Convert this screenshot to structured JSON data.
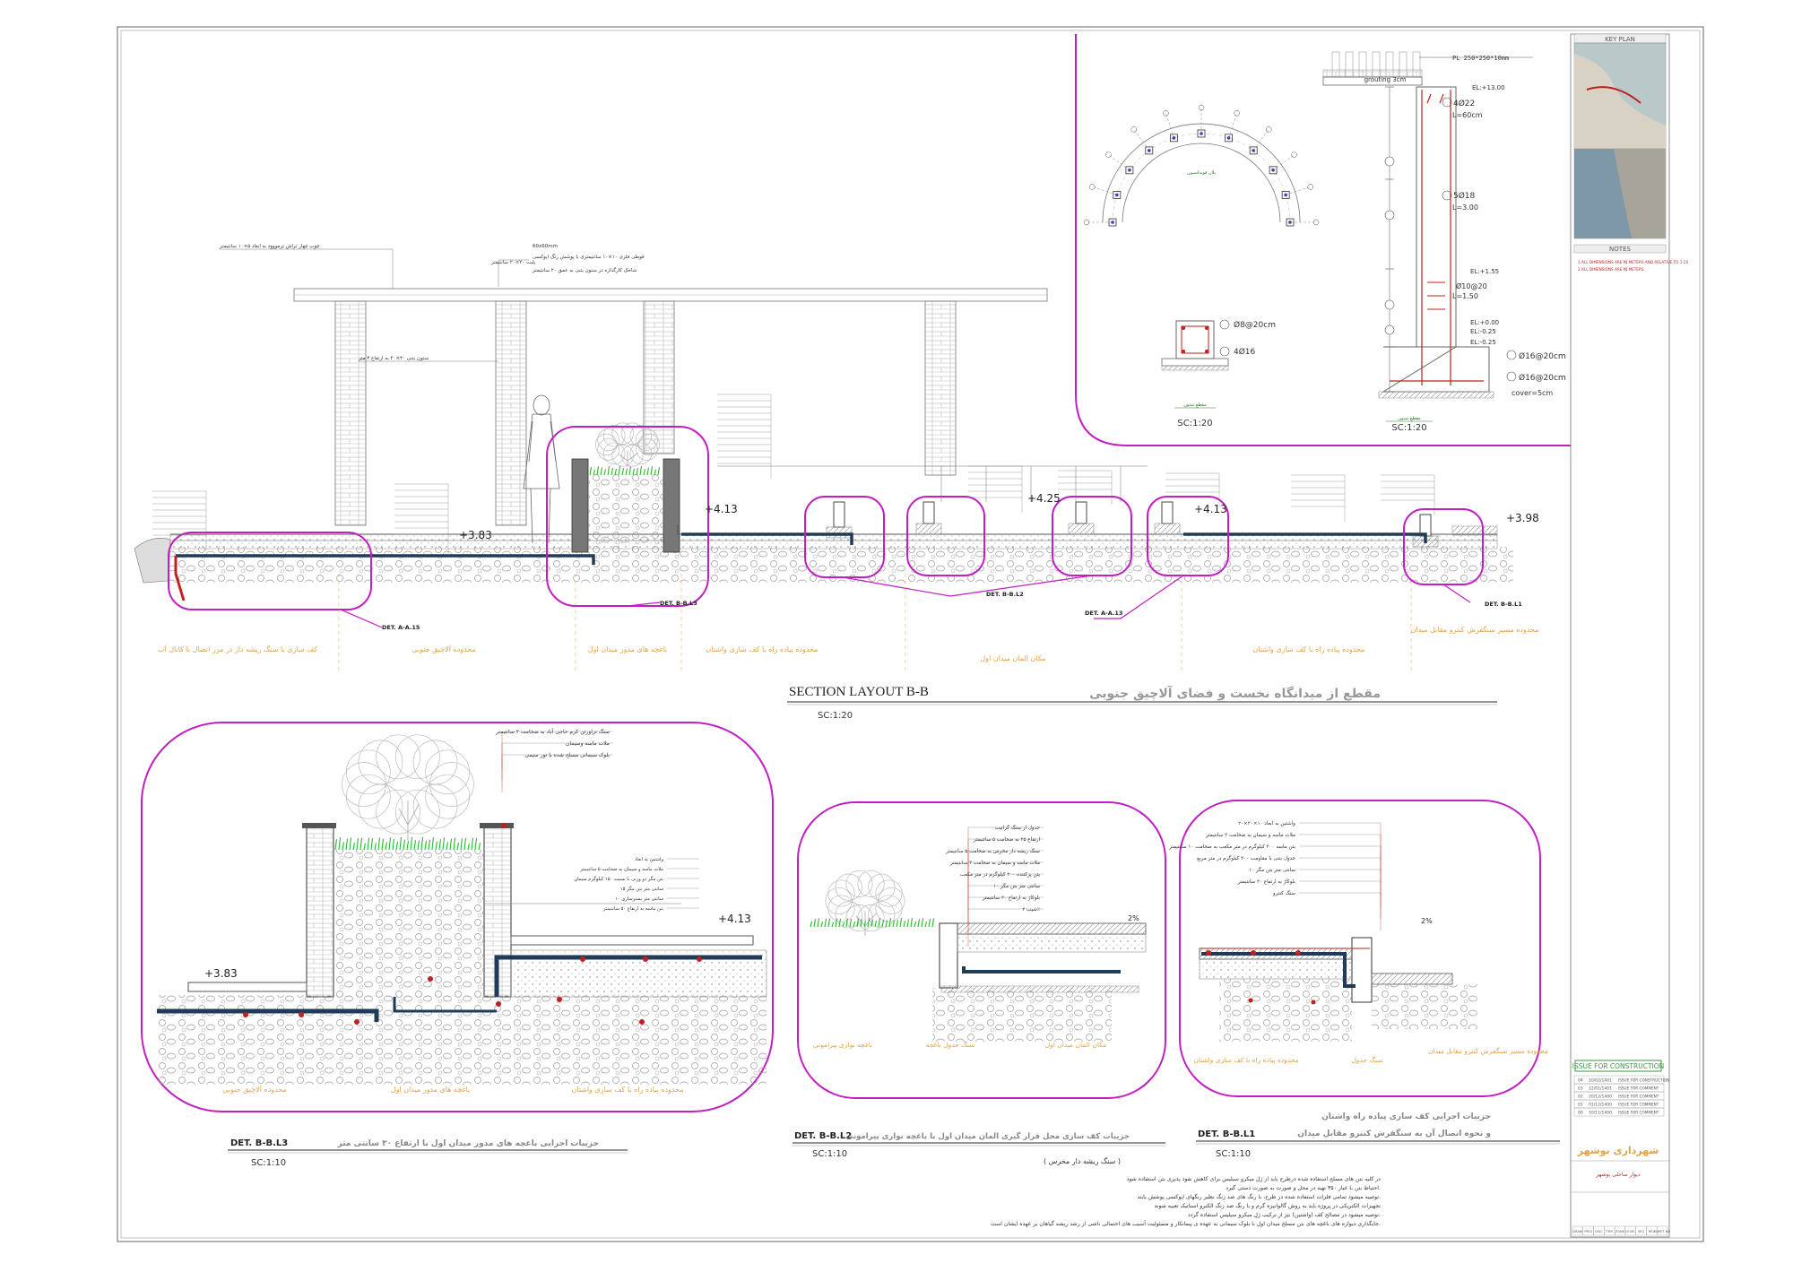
{
  "section_main": {
    "title": "SECTION LAYOUT B-B",
    "title_fa": "مقطع از میدانگاه نخست و فضای آلاچیق جنوبی",
    "scale": "SC:1:20",
    "levels": [
      "+3.83",
      "+4.13",
      "+4.25",
      "+4.13",
      "+3.98"
    ],
    "det_labels": [
      "DET. A-A.15",
      "DET. B-B.L3",
      "DET. B-B.L2",
      "DET. A-A.13",
      "DET. B-B.L1"
    ],
    "zones": [
      "کف سازی با سنگ ریشه دار در مرز اتصال با کانال آب",
      "محدوده آلاچیق جنوبی",
      "باغچه های مدور میدان اول",
      "محدوده پیاده راه با کف سازی واشتان",
      "مکان المان میدان اول",
      "محدوده پیاده راه با کف سازی واشتان",
      "محدوده مسیر سنگفرش کنترو مقابل میدان"
    ],
    "pergola_notes": [
      "چوب چهار تراش ترمووود به ابعاد ۵×۱۰ سانتیمتر",
      "60x60mm",
      "قوطی فلزی ۱۰×۱۰ سانتیمتری با پوشش رنگ اپوکسی",
      "پلیت ۲۰×۲۰ سانتیمتر",
      "شاخک کارگذاره در ستون بتنی به عمق ۲۰ سانتیمتر",
      "ستون بتنی ۴۰×۴۰ به ارتفاع ۳ متر"
    ]
  },
  "arch_detail": {
    "label": "پلان فونداسیون",
    "scale": "SC:1:20"
  },
  "column_detail": {
    "plate": "PL 250*250*10mm",
    "grouting": "grouting 3cm",
    "rebar_notes": [
      "4Ø22",
      "L=60cm",
      "5Ø18",
      "L=3.00",
      "Ø10@20",
      "L=1.50",
      "Ø16@20cm",
      "Ø16@20cm",
      "cover=5cm"
    ],
    "levels": [
      "EL:+13.00",
      "EL:+1.55",
      "EL:+0.00",
      "EL:-0.25",
      "EL:-0.25"
    ],
    "section_rebar": [
      "Ø8@20cm",
      "4Ø16"
    ],
    "label_left": "مقطع ستون",
    "label_right": "مقطع ستون",
    "scale_left": "SC:1:20",
    "scale_right": "SC:1:20"
  },
  "detail_l3": {
    "id": "DET. B-B.L3",
    "title_fa": "جزییات اجرایی باغچه های مدور میدان اول با ارتفاع ۳۰ سانتی متر",
    "scale": "SC:1:10",
    "levels": [
      "+3.83",
      "+4.13"
    ],
    "notes": [
      "سنگ تراورتن کرم حاجی آباد به ضخامت ۲ سانتیمتر",
      "ملات ماسه وسیمان",
      "بلوک سیمانی مسلح شده با تور سیمی",
      "واشتین به ابعاد",
      "ملات ماسه و سیمان به ضخامت ۵ سانتیمتر",
      "بتن مگر دو وزنی با نسبت ۱۵۰ کیلوگرم سیمان",
      "۱۵ سانتی متر بتن مگر",
      "۱۰ سانتی متر بسترسازی",
      "بتن ماسه به ارتفاع ۵۰ سانتیمتر"
    ],
    "zones": [
      "محدوده آلاچیق جنوبی",
      "باغچه های مدور میدان اول",
      "محدوده پیاده راه با کف سازی واشتان"
    ]
  },
  "detail_l2": {
    "id": "DET. B-B.L2",
    "title_fa": "جزییات کف سازی محل قرار گیری المان میدان اول با باغچه نواری پیرامونی",
    "subtitle_fa": "( سنگ ریشه دار مخرس )",
    "scale": "SC:1:10",
    "notes": [
      "جدول از سنگ گرانیت",
      "ارتفاع ۲۵ به ضخامت ۵ سانتیمتر",
      "سنگ ریشه دار مخرس به ضخامت ۵ سانتیمتر",
      "ملات ماسه و سیمان به ضخامت ۳ سانتیمتر",
      "بتن پرکننده ۲۰۰ کیلوگرم در متر مکعب",
      "۱۰ سانتی متر بتن مگر",
      "بلوکاژ به ارتفاع ۲۰ سانتیمتر",
      "شیب ۲٪"
    ],
    "slope": "2%",
    "zones": [
      "باغچه نواری پیرامونی",
      "سنگ جدول باغچه",
      "مکان المان میدان اول"
    ]
  },
  "detail_l1": {
    "id": "DET. B-B.L1",
    "title_fa": "جزییات اجرایی کف سازی پیاده راه واشتان",
    "title2_fa": "و نحوه اتصال آن به سنگفرش کنترو مقابل میدان",
    "scale": "SC:1:10",
    "notes": [
      "واشتین به ابعاد ۱۰×۲۰×۲۰",
      "ملات ماسه و سیمان به ضخامت ۳ سانتیمتر",
      "بتن ماسه ۳۰۰ کیلوگرم در متر مکعب به ضخامت ۱۰ سانتیمتر",
      "جدول بتنی با مقاومت ۳۰۰ کیلوگرم در متر مربع",
      "۱۰ سانتی متر بتن مگر",
      "بلوکاژ به ارتفاع ۲۰ سانتیمتر",
      "سنگ کنترو"
    ],
    "slope": "2%",
    "zones": [
      "محدوده پیاده راه با کف سازی واشتان",
      "سنگ جدول",
      "محدوده مسیر سنگفرش کنترو مقابل میدان"
    ]
  },
  "general_notes": [
    "در کلیه بتن های مسلح استفاده شده درطرح باید از ژل میکرو سیلیس برای کاهش نفوذ پذیری بتن استفاده شود",
    "احتیاط بتن با عیار ۳۵۰ تهیه در محل و صورت به صورت دستی گیرد.",
    "توصیه میشود تمامی فلزات استفاده شده در طرح، با رنگ های ضد زنگ نظیر رنگهای اپوکسی پوشش یابند.",
    "تجهیزات الکتریکی در پروژه باید به روش گالوانیزه گرم و با رنگ ضد زنگ الکترو استاتیک تعبیه شوند",
    "توصیه میشود در مصالح کف (واشتین) نیز از ترکیب ژل میکرو سیلیس استفاده گردد.",
    "جایگذاری دیواره های باغچه های بتن مسلح میدان اول با بلوک سیمانی به عهده ی پیمانکار و مسئولیت آسیب های احتمالی ناشی از رشد ریشه گیاهان بر عهده ایشان است."
  ],
  "title_block": {
    "key_plan": "KEY PLAN",
    "notes_header": "NOTES",
    "notes_text": [
      "1.ALL DIMENSIONS ARE IN METERS AND RELATIVE TO 1:10",
      "2.ALL DIMENSIONS ARE IN METERS"
    ],
    "issue_stamp": "ISSUE FOR CONSTRUCTION",
    "revisions": [
      [
        "04",
        "10/02/1401",
        "ISSUE FOR CONSTRUCTION"
      ],
      [
        "03",
        "12/01/1401",
        "ISSUE FOR COMMENT"
      ],
      [
        "02",
        "20/12/1400",
        "ISSUE FOR COMMENT"
      ],
      [
        "01",
        "01/12/1400",
        "ISSUE FOR COMMENT"
      ],
      [
        "00",
        "10/11/1400",
        "ISSUE FOR COMMENT"
      ]
    ],
    "client": "شهرداری بوشهر",
    "project": "دیوار ساحلی بوشهر",
    "footer_cols": [
      "DRAW",
      "PROJ",
      "DISC",
      "TYPE",
      "ZONE",
      "LEVEL",
      "SEQ",
      "REV",
      "SHEET NO"
    ]
  },
  "colors": {
    "highlight": "#c21fc2",
    "pipe": "#1f3b57",
    "dimension": "#2a7a2a",
    "annotation": "#333333",
    "zone_text": "#e0a24a",
    "rebar": "#c21f1f"
  }
}
